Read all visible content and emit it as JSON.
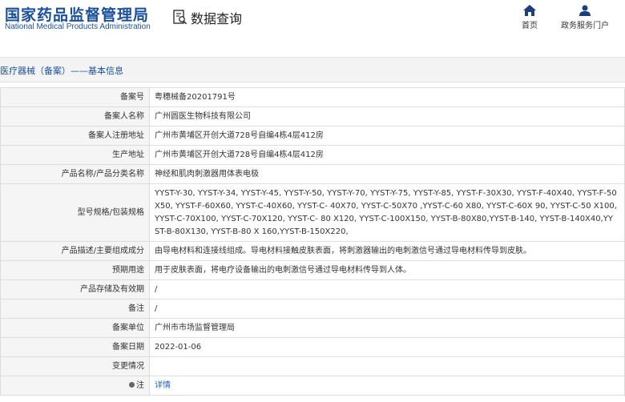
{
  "header": {
    "logo_cn": "国家药品监督管理局",
    "logo_en": "National Medical Products Administration",
    "query_label": "数据查询",
    "nav": {
      "home": "首页",
      "portal": "政务服务门户"
    }
  },
  "section": {
    "title": "医疗器械（备案）——基本信息"
  },
  "rows": [
    {
      "label": "备案号",
      "value": "粤穗械备20201791号"
    },
    {
      "label": "备案人名称",
      "value": "广州圆医生物科技有限公司"
    },
    {
      "label": "备案人注册地址",
      "value": "广州市黄埔区开创大道728号自编4栋4层412房"
    },
    {
      "label": "生产地址",
      "value": "广州市黄埔区开创大道728号自编4栋4层412房"
    },
    {
      "label": "产品名称/产品分类名称",
      "value": "神经和肌肉刺激器用体表电极"
    },
    {
      "label": "型号规格/包装规格",
      "value": "YYST-Y-30, YYST-Y-34, YYST-Y-45, YYST-Y-50, YYST-Y-70, YYST-Y-75, YYST-Y-85, YYST-F-30X30, YYST-F-40X40, YYST-F-50X50, YYST-F-60X60, YYST-C-40X60, YYST-C- 40X70, YYST-C-50X70 ,YYST-C-60 X80, YYST-C-60X 90, YYST-C-50 X100, YYST-C-70X100, YYST-C-70X120, YYST-C- 80 X120, YYST-C-100X150, YYST-B-80X80,YYST-B-140, YYST-B-140X40,YYST-B-80X130, YYST-B-80 X 160,YYST-B-150X220,"
    },
    {
      "label": "产品描述/主要组成成分",
      "value": "由导电材料和连接线组成。导电材料接触皮肤表面，将刺激器输出的电刺激信号通过导电材料传导到皮肤。"
    },
    {
      "label": "预期用途",
      "value": "用于皮肤表面，将电疗设备输出的电刺激信号通过导电材料传导到人体。"
    },
    {
      "label": "产品存储及有效期",
      "value": "/"
    },
    {
      "label": "备注",
      "value": "/"
    },
    {
      "label": "备案单位",
      "value": "广州市市场监督管理局"
    },
    {
      "label": "备案日期",
      "value": "2022-01-06"
    },
    {
      "label": "变更情况",
      "value": ""
    },
    {
      "label": "注",
      "value": "详情"
    }
  ],
  "colors": {
    "brand": "#1a4f9c",
    "link": "#1a63c4",
    "label_bg": "#f5f5f5",
    "border": "#dcdcdc"
  }
}
